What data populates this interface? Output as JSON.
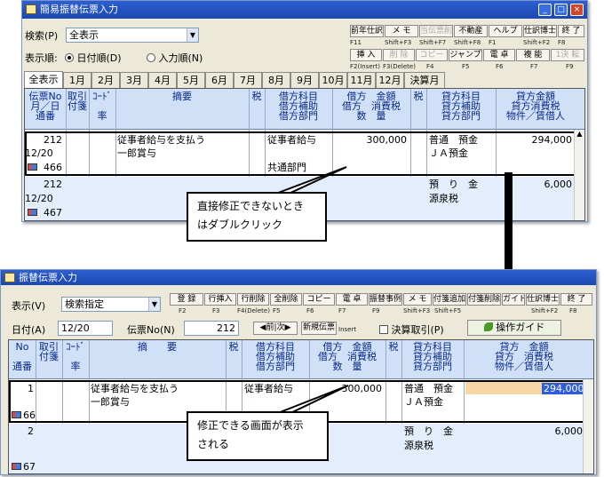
{
  "top_window": {
    "title": "簡易振替伝票入力",
    "search_label": "検索(P)",
    "search_value": "全表示",
    "order_label": "表示順:",
    "order_date": "日付順(D)",
    "order_input": "入力順(N)",
    "toolbar_row1": [
      {
        "label": "前年仕訳",
        "key": "F11"
      },
      {
        "label": "メ モ",
        "key": "Shift+F3"
      },
      {
        "label": "当伝票削",
        "key": "Shift+F7"
      },
      {
        "label": "不動産",
        "key": "Shift+F8"
      },
      {
        "label": "ヘルプ",
        "key": "F1"
      },
      {
        "label": "仕訳博士",
        "key": "Shift+F2"
      },
      {
        "label": "終 了",
        "key": "F8"
      }
    ],
    "toolbar_row2": [
      {
        "label": "挿 入",
        "key": "F2(Insert)"
      },
      {
        "label": "削 除",
        "key": "F3(Delete)"
      },
      {
        "label": "コピー",
        "key": "F4"
      },
      {
        "label": "ジャンプ",
        "key": "F5"
      },
      {
        "label": "電 卓",
        "key": "F6"
      },
      {
        "label": "複 能",
        "key": "F7"
      },
      {
        "label": "1決 転",
        "key": "F9"
      }
    ],
    "tabs": [
      "全表示",
      "1月",
      "2月",
      "3月",
      "4月",
      "5月",
      "6月",
      "7月",
      "8月",
      "9月",
      "10月",
      "11月",
      "12月",
      "決算月"
    ],
    "headers": {
      "col1": [
        "伝票No",
        "月／日",
        "通番"
      ],
      "col2": [
        "取引",
        "付箋",
        ""
      ],
      "col3": [
        "ｺｰﾄﾞ",
        "",
        "率"
      ],
      "col4": [
        "摘要"
      ],
      "col5": [
        "税"
      ],
      "col6": [
        "借方科目",
        "借方補助",
        "借方部門"
      ],
      "col7": [
        "借方　金額",
        "借方　消費税",
        "数　量"
      ],
      "col8": [
        "税"
      ],
      "col9": [
        "貸方科目",
        "貸方補助",
        "貸方部門"
      ],
      "col10": [
        "貸方金額",
        "貸方消費税",
        "物件／賃借人"
      ]
    },
    "rows": [
      {
        "no": "212",
        "date": "12/20",
        "serial": "466",
        "desc1": "従事者給与を支払う",
        "desc2": "一郎賞与",
        "debit_account": "従事者給与",
        "debit_dept": "共通部門",
        "debit_amount": "300,000",
        "credit_account": "普通　預金",
        "credit_sub": "ＪＡ預金",
        "credit_amount": "294,000"
      },
      {
        "no": "212",
        "date": "12/20",
        "serial": "467",
        "credit_account": "預　り　金",
        "credit_sub": "源泉税",
        "credit_amount": "6,000"
      }
    ]
  },
  "bottom_window": {
    "title": "振替伝票入力",
    "view_label": "表示(V)",
    "view_value": "検索指定",
    "toolbar": [
      {
        "label": "登 録",
        "key": "F2"
      },
      {
        "label": "行挿入",
        "key": "F3"
      },
      {
        "label": "行削除",
        "key": "F4(Delete)"
      },
      {
        "label": "全削除",
        "key": "F5"
      },
      {
        "label": "コピー",
        "key": "F6"
      },
      {
        "label": "電 卓",
        "key": "F7"
      },
      {
        "label": "振替事例",
        "key": "F9"
      },
      {
        "label": "メ モ",
        "key": "Shift+F3"
      },
      {
        "label": "付箋追加",
        "key": "Shift+F5"
      },
      {
        "label": "付箋削除",
        "key": ""
      },
      {
        "label": "ガイド",
        "key": ""
      },
      {
        "label": "仕訳博士",
        "key": "Shift+F2"
      },
      {
        "label": "終 了",
        "key": "F8"
      }
    ],
    "date_label": "日付(A)",
    "date_value": "12/20",
    "slip_label": "伝票No(N)",
    "slip_value": "212",
    "prev_next": "◀前|次▶",
    "new_slip": "新規伝票",
    "insert_key": "Insert",
    "closing_label": "決算取引(P)",
    "guide_button": "操作ガイド",
    "headers": {
      "col1": [
        "No",
        "",
        "通番"
      ],
      "col2": [
        "取引",
        "付箋",
        ""
      ],
      "col3": [
        "ｺｰﾄﾞ",
        "",
        "率"
      ],
      "col4": [
        "摘　　要"
      ],
      "col5": [
        "税"
      ],
      "col6": [
        "借方科目",
        "借方補助",
        "借方部門"
      ],
      "col7": [
        "借方　金額",
        "借方　消費税",
        "数　量"
      ],
      "col8": [
        "税"
      ],
      "col9": [
        "貸方科目",
        "貸方補助",
        "貸方部門"
      ],
      "col10": [
        "貸方　金額",
        "貸方　消費税",
        "物件／賃借人"
      ]
    },
    "rows": [
      {
        "no": "1",
        "serial": "66",
        "desc1": "従事者給与を支払う",
        "desc2": "一郎賞与",
        "debit_account": "従事者給与",
        "debit_amount": "300,000",
        "credit_account": "普通　預金",
        "credit_sub": "ＪＡ預金",
        "credit_amount": "294,000"
      },
      {
        "no": "2",
        "serial": "67",
        "credit_account": "預　り　金",
        "credit_sub": "源泉税",
        "credit_amount": "6,000"
      }
    ]
  },
  "callouts": {
    "top": [
      "直接修正できないとき",
      "はダブルクリック"
    ],
    "bottom": [
      "修正できる画面が表示",
      "される"
    ]
  }
}
